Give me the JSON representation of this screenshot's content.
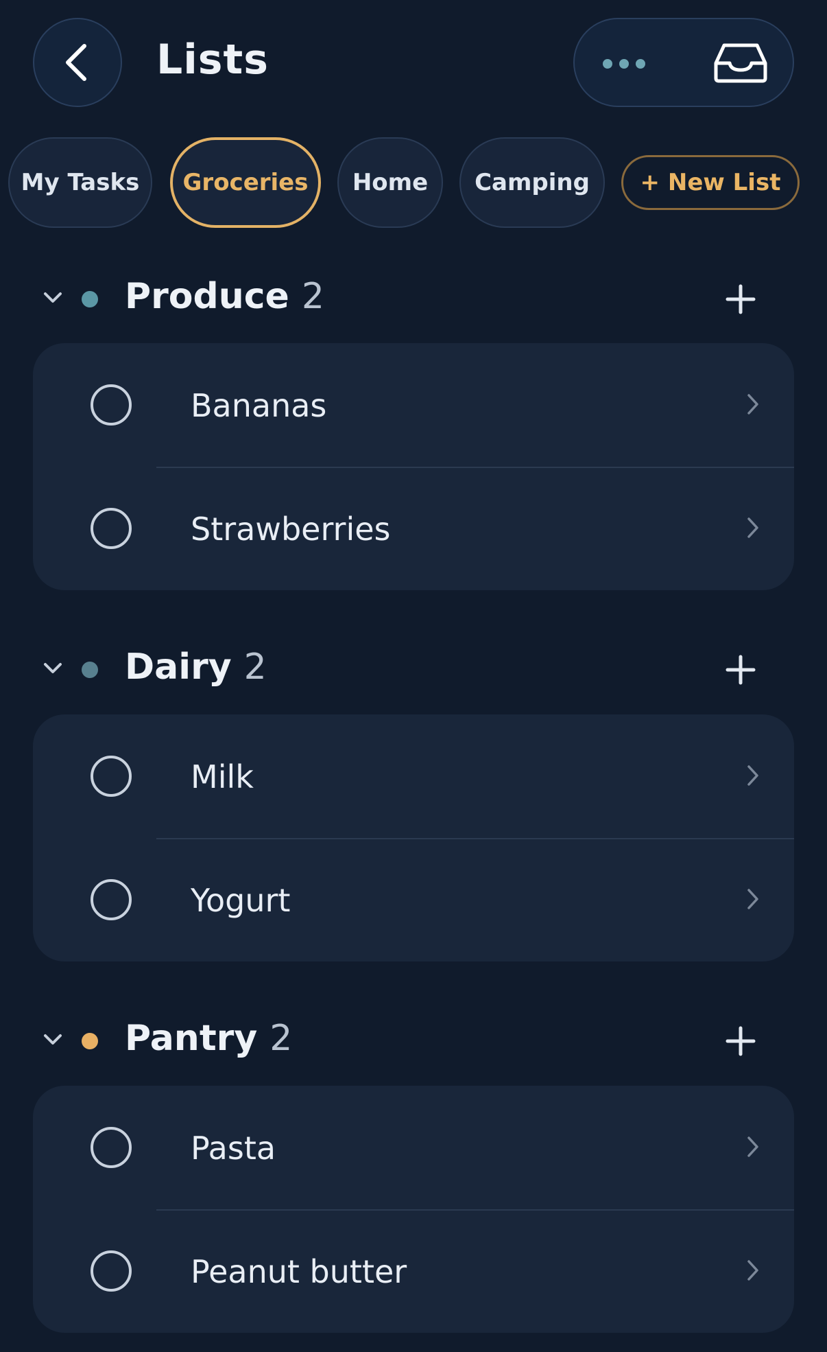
{
  "header": {
    "title": "Lists"
  },
  "tabs": [
    {
      "label": "My Tasks"
    },
    {
      "label": "Groceries"
    },
    {
      "label": "Home"
    },
    {
      "label": "Camping"
    },
    {
      "label": "+ New List"
    }
  ],
  "sections": [
    {
      "title": "Produce",
      "count": "2",
      "dot_color": "#5b97a5",
      "items": [
        {
          "label": "Bananas"
        },
        {
          "label": "Strawberries"
        }
      ]
    },
    {
      "title": "Dairy",
      "count": "2",
      "dot_color": "#58808f",
      "items": [
        {
          "label": "Milk"
        },
        {
          "label": "Yogurt"
        }
      ]
    },
    {
      "title": "Pantry",
      "count": "2",
      "dot_color": "#e8b064",
      "items": [
        {
          "label": "Pasta"
        },
        {
          "label": "Peanut butter"
        }
      ]
    }
  ],
  "icons": {
    "back": "chevron-left-icon",
    "more": "more-dots-icon",
    "inbox": "inbox-icon",
    "collapse": "chevron-down-icon",
    "add": "plus-icon",
    "open": "chevron-right-icon"
  },
  "colors": {
    "accent": "#e3b266",
    "background": "#101b2c",
    "card": "#19263a"
  }
}
